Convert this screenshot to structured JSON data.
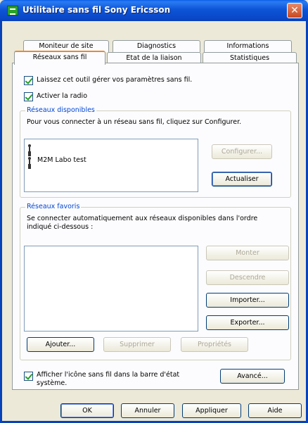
{
  "window": {
    "title": "Utilitaire sans fil Sony Ericsson",
    "close_glyph": "✕"
  },
  "tabs": {
    "row1": [
      "Moniteur de site",
      "Diagnostics",
      "Informations"
    ],
    "row2": [
      "Réseaux sans fil",
      "Etat de la liaison",
      "Statistiques"
    ],
    "active": "Réseaux sans fil"
  },
  "options": {
    "manage_label": "Laissez cet outil gérer vos paramètres sans fil.",
    "manage_checked": true,
    "radio_label": "Activer la radio",
    "radio_checked": true
  },
  "available": {
    "title": "Réseaux disponibles",
    "description": "Pour vous connecter à un réseau sans fil, cliquez sur Configurer.",
    "networks": [
      "",
      "M2M Labo test"
    ],
    "configure_label": "Configurer...",
    "refresh_label": "Actualiser"
  },
  "favorites": {
    "title": "Réseaux favoris",
    "description": "Se connecter automatiquement aux réseaux disponibles dans l'ordre indiqué ci-dessous :",
    "up_label": "Monter",
    "down_label": "Descendre",
    "import_label": "Importer...",
    "export_label": "Exporter...",
    "add_label": "Ajouter...",
    "remove_label": "Supprimer",
    "properties_label": "Propriétés"
  },
  "tray": {
    "label": "Afficher l'icône sans fil dans la barre d'état système.",
    "checked": true,
    "advanced_label": "Avancé..."
  },
  "footer": {
    "ok_label": "OK",
    "cancel_label": "Annuler",
    "apply_label": "Appliquer",
    "help_label": "Aide"
  },
  "icons": {
    "app": "sony-ericsson-utility-icon",
    "network": "wireless-network-icon"
  }
}
